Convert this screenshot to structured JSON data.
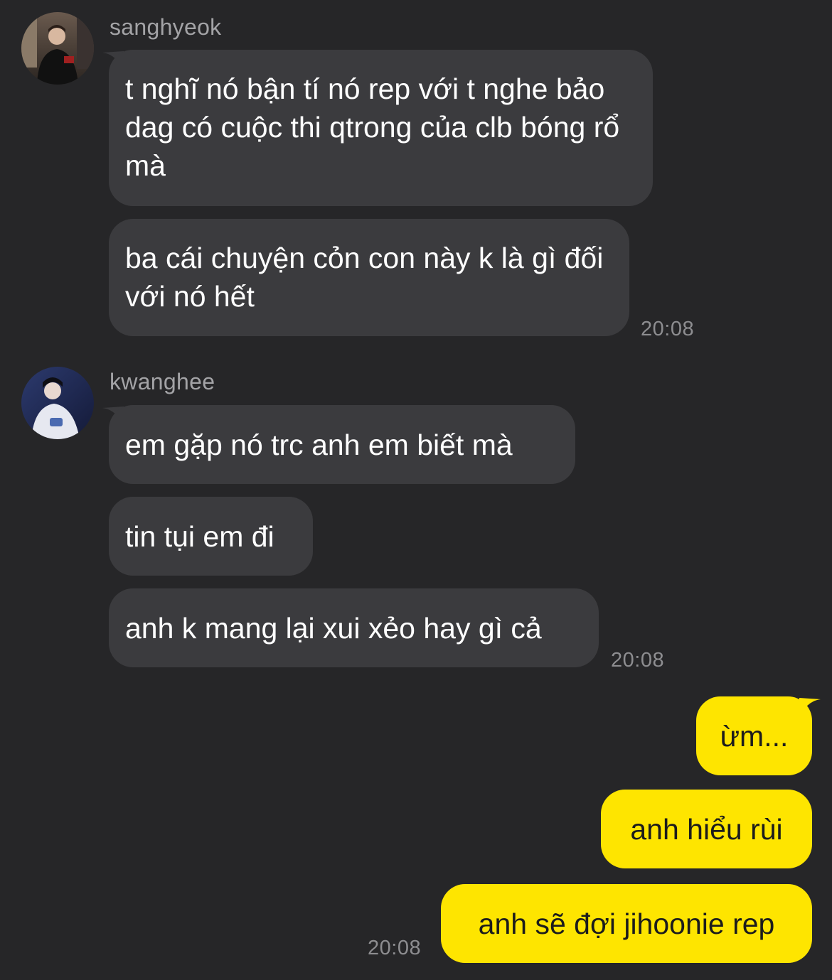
{
  "groups": [
    {
      "sender": "sanghyeok",
      "avatar_icon": "person-photo-avatar",
      "messages": [
        "t nghĩ nó bận tí nó rep với t nghe bảo dag có cuộc thi qtrong của clb bóng rổ mà",
        "ba cái chuyện cỏn con này k là gì đối với nó hết"
      ],
      "time": "20:08"
    },
    {
      "sender": "kwanghee",
      "avatar_icon": "person-photo-avatar",
      "messages": [
        "em gặp nó trc anh em biết mà",
        "tin tụi em đi",
        "anh k mang lại xui xẻo hay gì cả"
      ],
      "time": "20:08"
    }
  ],
  "mine": {
    "messages": [
      "ừm...",
      "anh hiểu rùi",
      "anh sẽ đợi jihoonie rep"
    ],
    "time": "20:08"
  },
  "colors": {
    "background": "#262628",
    "incoming_bubble": "#3b3b3e",
    "outgoing_bubble": "#fee500"
  }
}
